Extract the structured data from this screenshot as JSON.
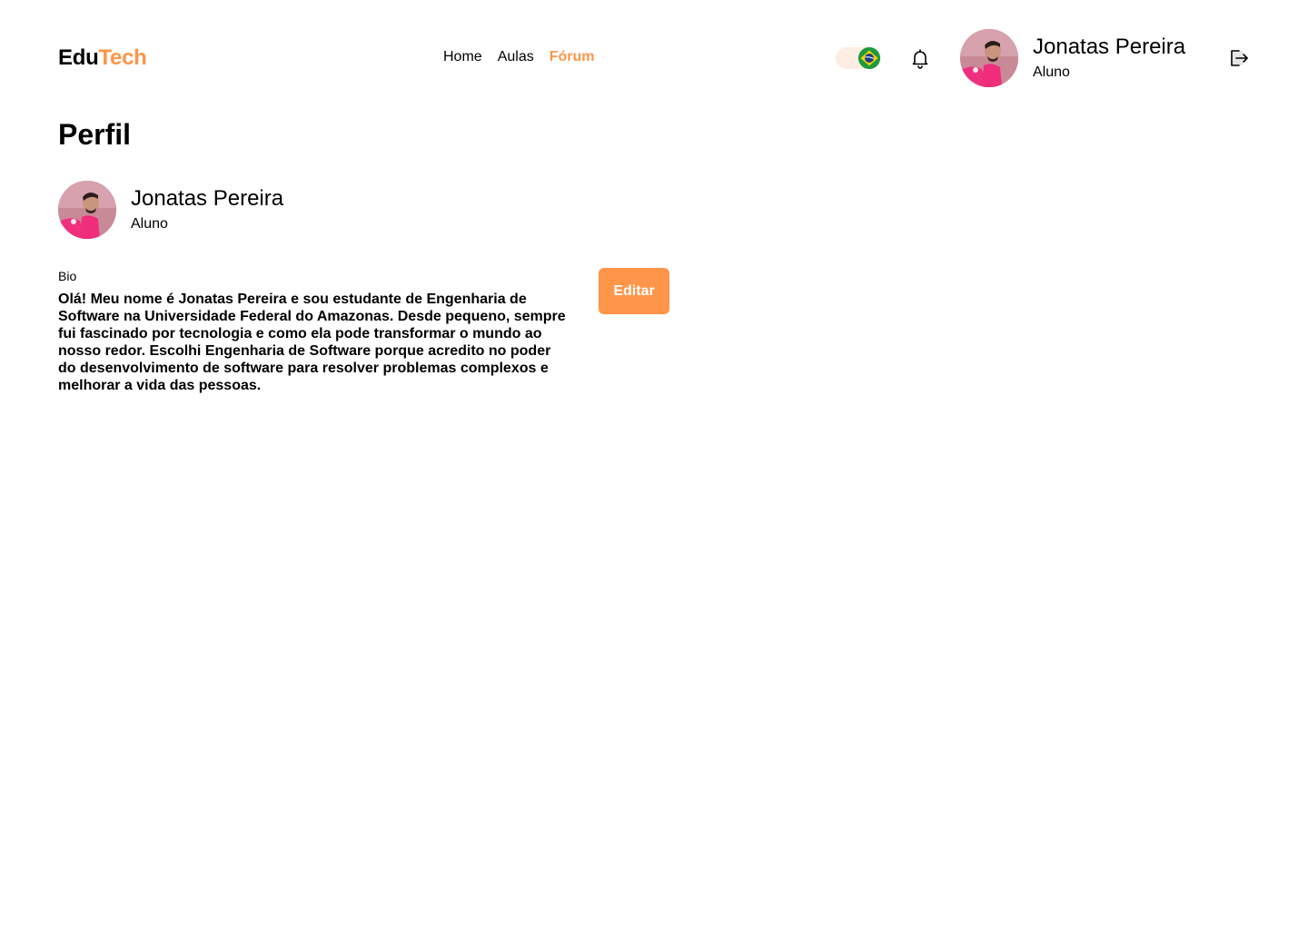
{
  "header": {
    "logo_part1": "Edu",
    "logo_part2": "Tech",
    "nav": [
      {
        "label": "Home",
        "active": false
      },
      {
        "label": "Aulas",
        "active": false
      },
      {
        "label": "Fórum",
        "active": true
      }
    ],
    "language_icon": "brazil-flag-icon",
    "notification_icon": "bell-icon",
    "user": {
      "name": "Jonatas Pereira",
      "role": "Aluno"
    },
    "logout_icon": "logout-icon"
  },
  "page": {
    "title": "Perfil",
    "profile": {
      "name": "Jonatas Pereira",
      "role": "Aluno"
    },
    "bio_label": "Bio",
    "bio_text": "Olá! Meu nome é Jonatas Pereira e sou estudante de Engenharia de Software na Universidade Federal do Amazonas. Desde pequeno, sempre fui fascinado por tecnologia e como ela pode transformar o mundo ao nosso redor. Escolhi Engenharia de Software porque acredito no poder do desenvolvimento de software para resolver problemas complexos e melhorar a vida das pessoas.",
    "edit_label": "Editar"
  },
  "colors": {
    "accent": "#FF9548",
    "toggle_bg": "#FDEEE3"
  }
}
